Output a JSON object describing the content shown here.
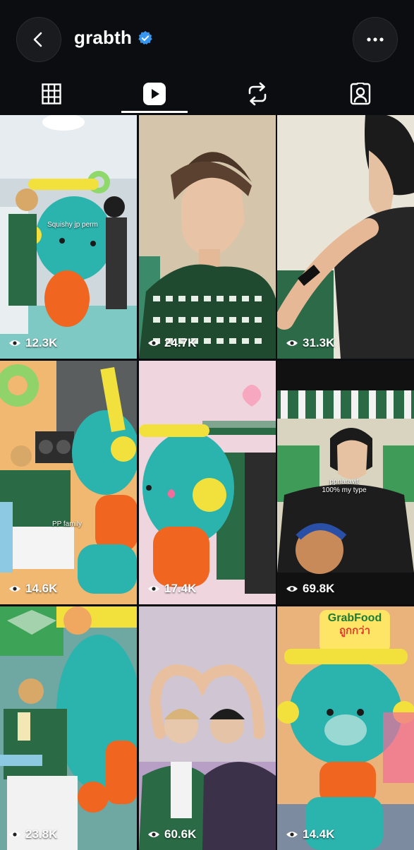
{
  "header": {
    "username": "grabth",
    "verified": true,
    "back_icon": "chevron-left-icon",
    "more_icon": "ellipsis-icon"
  },
  "tabs": [
    {
      "name": "grid",
      "icon": "grid-icon",
      "active": false
    },
    {
      "name": "reels",
      "icon": "reels-icon",
      "active": true
    },
    {
      "name": "reposts",
      "icon": "repost-icon",
      "active": false
    },
    {
      "name": "tagged",
      "icon": "tagged-person-icon",
      "active": false
    }
  ],
  "colors": {
    "background": "#0c0d10",
    "verified_badge": "#3797f0",
    "mascot_teal": "#2bb3ad",
    "mascot_orange": "#f0651f",
    "headphone_yellow": "#f2e13d"
  },
  "reels": [
    {
      "views": "12.3K",
      "caption": "Squishy jp perm"
    },
    {
      "views": "24.7K",
      "caption": ""
    },
    {
      "views": "31.3K",
      "caption": ""
    },
    {
      "views": "14.6K",
      "caption": "PP family"
    },
    {
      "views": "17.4K",
      "caption": ""
    },
    {
      "views": "69.8K",
      "caption": "ppnaravit\n100% my type"
    },
    {
      "views": "23.8K",
      "caption": ""
    },
    {
      "views": "60.6K",
      "caption": ""
    },
    {
      "views": "14.4K",
      "caption": ""
    }
  ],
  "signs": {
    "reel9_top": "GrabFood",
    "reel9_sub": "ถูกกว่า"
  }
}
